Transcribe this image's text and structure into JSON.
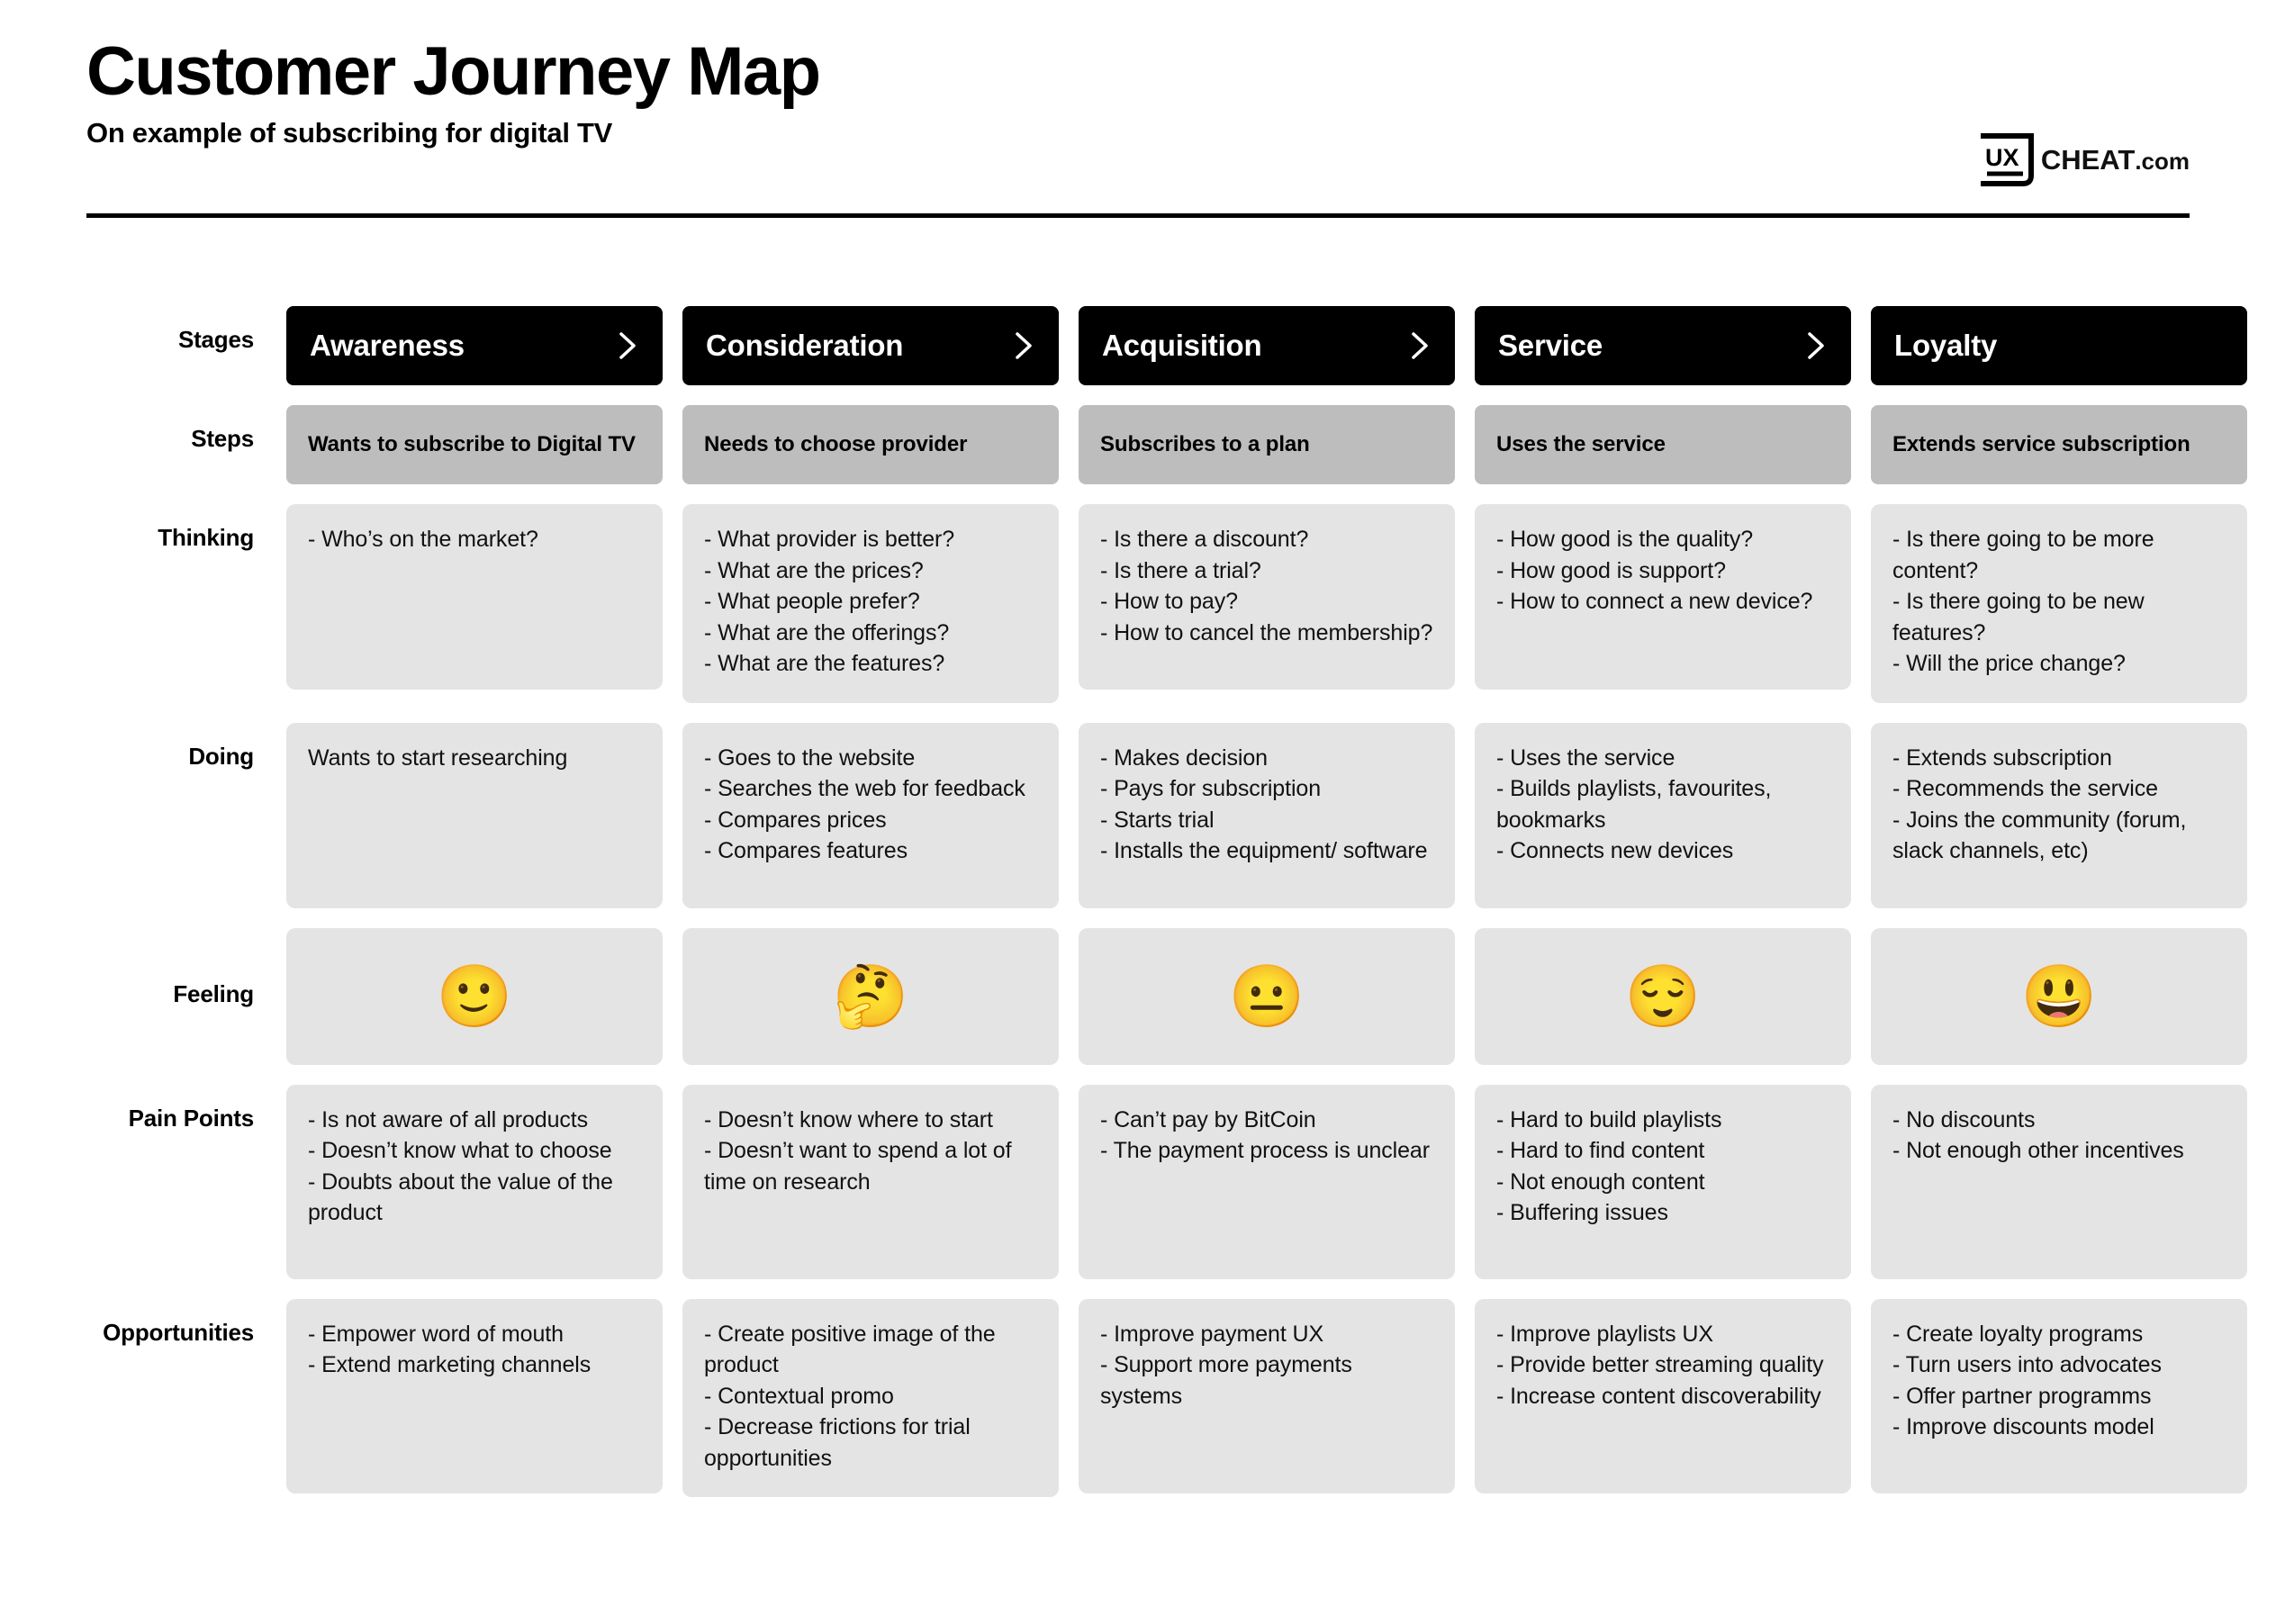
{
  "header": {
    "title": "Customer Journey Map",
    "subtitle": "On example of subscribing for digital TV",
    "brand": {
      "mark_text": "UX",
      "name": "CHEAT",
      "tld": ".com",
      "icon": "ux-cheat-logo-icon"
    }
  },
  "row_labels": {
    "stages": "Stages",
    "steps": "Steps",
    "thinking": "Thinking",
    "doing": "Doing",
    "feeling": "Feeling",
    "pain_points": "Pain Points",
    "opportunities": "Opportunities"
  },
  "colors": {
    "stage_bg": "#000000",
    "stage_text": "#ffffff",
    "step_bg": "#bdbdbd",
    "cell_bg": "#e4e4e4",
    "text": "#111111",
    "rule": "#000000"
  },
  "columns": [
    {
      "stage": "Awareness",
      "has_chevron": true,
      "step": "Wants to subscribe to Digital TV",
      "thinking": [
        "- Who’s on the market?"
      ],
      "doing": [
        "Wants to start researching"
      ],
      "feeling": {
        "emoji": "🙂",
        "name": "slightly-smiling-face-emoji"
      },
      "pain_points": [
        "- Is not aware of all products",
        "- Doesn’t know what to choose",
        "- Doubts about the value of the product"
      ],
      "opportunities": [
        "- Empower word of mouth",
        "- Extend marketing channels"
      ]
    },
    {
      "stage": "Consideration",
      "has_chevron": true,
      "step": "Needs to choose provider",
      "thinking": [
        "- What provider is better?",
        "- What are the prices?",
        "- What people prefer?",
        "- What are the offerings?",
        "- What are the features?"
      ],
      "doing": [
        "- Goes to the website",
        "- Searches the web for feedback",
        "- Compares prices",
        "- Compares features"
      ],
      "feeling": {
        "emoji": "🤔",
        "name": "thinking-face-emoji"
      },
      "pain_points": [
        "- Doesn’t know where to start",
        "- Doesn’t want to spend a lot of time on research"
      ],
      "opportunities": [
        "- Create positive image of the product",
        "- Contextual promo",
        "- Decrease frictions for trial opportunities"
      ]
    },
    {
      "stage": "Acquisition",
      "has_chevron": true,
      "step": "Subscribes to a plan",
      "thinking": [
        "- Is there a discount?",
        "- Is there a trial?",
        "- How to pay?",
        "- How to cancel the membership?"
      ],
      "doing": [
        "- Makes decision",
        "- Pays for subscription",
        "- Starts trial",
        "- Installs the equipment/ software"
      ],
      "feeling": {
        "emoji": "😐",
        "name": "neutral-face-emoji"
      },
      "pain_points": [
        "- Can’t pay by BitCoin",
        "- The payment process is unclear"
      ],
      "opportunities": [
        "- Improve payment UX",
        "- Support more payments systems"
      ]
    },
    {
      "stage": "Service",
      "has_chevron": true,
      "step": "Uses the service",
      "thinking": [
        "- How good is the quality?",
        "- How good is support?",
        "- How to connect a new device?"
      ],
      "doing": [
        "- Uses the service",
        "- Builds playlists, favourites, bookmarks",
        "- Connects new devices"
      ],
      "feeling": {
        "emoji": "😌",
        "name": "relieved-face-emoji"
      },
      "pain_points": [
        "- Hard to build playlists",
        "- Hard to find content",
        "- Not enough content",
        "- Buffering issues"
      ],
      "opportunities": [
        "- Improve playlists UX",
        "- Provide better streaming quality",
        "- Increase content discoverability"
      ]
    },
    {
      "stage": "Loyalty",
      "has_chevron": false,
      "step": "Extends  service subscription",
      "thinking": [
        "- Is there going to be more content?",
        "- Is there going to be new features?",
        "- Will the price change?"
      ],
      "doing": [
        "- Extends subscription",
        "- Recommends the service",
        "- Joins the community (forum, slack channels, etc)"
      ],
      "feeling": {
        "emoji": "😃",
        "name": "grinning-face-with-big-eyes-emoji"
      },
      "pain_points": [
        "- No discounts",
        "- Not enough other incentives"
      ],
      "opportunities": [
        "- Create loyalty programs",
        "- Turn users into advocates",
        "- Offer partner programms",
        "- Improve discounts model"
      ]
    }
  ]
}
